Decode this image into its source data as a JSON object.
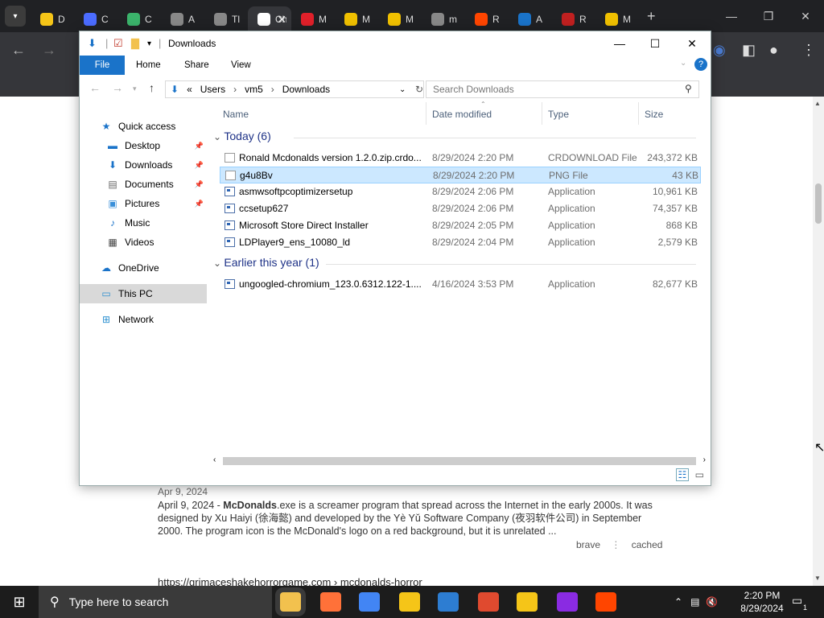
{
  "browser": {
    "tabs": [
      {
        "label": "D",
        "color": "#f5c518"
      },
      {
        "label": "C",
        "color": "#4b6cff"
      },
      {
        "label": "C",
        "color": "#3bb36b"
      },
      {
        "label": "A",
        "color": "#888888"
      },
      {
        "label": "Tl",
        "color": "#888888"
      },
      {
        "label": "Ch",
        "color": "#ffffff",
        "active": true
      },
      {
        "label": "M",
        "color": "#e0202a"
      },
      {
        "label": "M",
        "color": "#f0c000"
      },
      {
        "label": "M",
        "color": "#f0c000"
      },
      {
        "label": "m",
        "color": "#888888"
      },
      {
        "label": "R",
        "color": "#ff4500"
      },
      {
        "label": "A",
        "color": "#1a73c9"
      },
      {
        "label": "R",
        "color": "#c02020"
      },
      {
        "label": "M",
        "color": "#f0c000"
      }
    ],
    "newtab": "+",
    "close_tab": "✕"
  },
  "explorer": {
    "title": "Downloads",
    "ribbon_tabs": [
      "File",
      "Home",
      "Share",
      "View"
    ],
    "breadcrumb": [
      "«",
      "Users",
      "›",
      "vm5",
      "›",
      "Downloads"
    ],
    "search_placeholder": "Search Downloads",
    "nav": [
      {
        "label": "Quick access",
        "icon": "star-icon",
        "indent": 0
      },
      {
        "label": "Desktop",
        "icon": "desktop-icon",
        "indent": 1,
        "pinned": true
      },
      {
        "label": "Downloads",
        "icon": "download-icon",
        "indent": 1,
        "pinned": true
      },
      {
        "label": "Documents",
        "icon": "documents-icon",
        "indent": 1,
        "pinned": true
      },
      {
        "label": "Pictures",
        "icon": "pictures-icon",
        "indent": 1,
        "pinned": true
      },
      {
        "label": "Music",
        "icon": "music-icon",
        "indent": 1
      },
      {
        "label": "Videos",
        "icon": "videos-icon",
        "indent": 1
      },
      {
        "label": "OneDrive",
        "icon": "cloud-icon",
        "indent": 0
      },
      {
        "label": "This PC",
        "icon": "pc-icon",
        "indent": 0,
        "selected": true
      },
      {
        "label": "Network",
        "icon": "network-icon",
        "indent": 0
      }
    ],
    "columns": [
      "Name",
      "Date modified",
      "Type",
      "Size"
    ],
    "groups": [
      {
        "label": "Today (6)",
        "files": [
          {
            "name": "Ronald Mcdonalds version 1.2.0.zip.crdo...",
            "date": "8/29/2024 2:20 PM",
            "type": "CRDOWNLOAD File",
            "size": "243,372 KB",
            "icon": "doc"
          },
          {
            "name": "g4u8Bv",
            "date": "8/29/2024 2:20 PM",
            "type": "PNG File",
            "size": "43 KB",
            "icon": "doc",
            "selected": true
          },
          {
            "name": "asmwsoftpcoptimizersetup",
            "date": "8/29/2024 2:06 PM",
            "type": "Application",
            "size": "10,961 KB",
            "icon": "app"
          },
          {
            "name": "ccsetup627",
            "date": "8/29/2024 2:06 PM",
            "type": "Application",
            "size": "74,357 KB",
            "icon": "app"
          },
          {
            "name": "Microsoft Store Direct Installer",
            "date": "8/29/2024 2:05 PM",
            "type": "Application",
            "size": "868 KB",
            "icon": "app"
          },
          {
            "name": "LDPlayer9_ens_10080_ld",
            "date": "8/29/2024 2:04 PM",
            "type": "Application",
            "size": "2,579 KB",
            "icon": "app"
          }
        ]
      },
      {
        "label": "Earlier this year (1)",
        "files": [
          {
            "name": "ungoogled-chromium_123.0.6312.122-1....",
            "date": "4/16/2024 3:53 PM",
            "type": "Application",
            "size": "82,677 KB",
            "icon": "app"
          }
        ]
      }
    ]
  },
  "webpage": {
    "result_date": "Apr 9, 2024",
    "snippet_prefix": "April 9, 2024 - ",
    "snippet_bold": "McDonalds",
    "snippet_rest": ".exe is a screamer program that spread across the Internet in the early 2000s. It was designed by Xu Haiyi (徐海懿) and developed by the Yè Yǔ Software Company (夜羽软件公司) in September 2000. The program icon is the McDonald's logo on a red background, but it is unrelated ...",
    "link_brave": "brave",
    "link_cached": "cached",
    "next_url": "https://grimaceshakehorrorgame.com › mcdonalds-horror"
  },
  "taskbar": {
    "search_placeholder": "Type here to search",
    "time": "2:20 PM",
    "date": "8/29/2024",
    "apps": [
      {
        "name": "file-explorer-icon",
        "color": "#f2c14e"
      },
      {
        "name": "firefox-icon",
        "color": "#ff7139"
      },
      {
        "name": "chrome-icon",
        "color": "#4285f4"
      },
      {
        "name": "ldplayer-icon",
        "color": "#f5c518"
      },
      {
        "name": "store-icon",
        "color": "#2d7dd2"
      },
      {
        "name": "app-red-icon",
        "color": "#e04a2f"
      },
      {
        "name": "ldplayer2-icon",
        "color": "#f5c518"
      },
      {
        "name": "winrar-icon",
        "color": "#8a2be2"
      },
      {
        "name": "reddit-icon",
        "color": "#ff4500"
      }
    ],
    "notification_count": "1"
  }
}
